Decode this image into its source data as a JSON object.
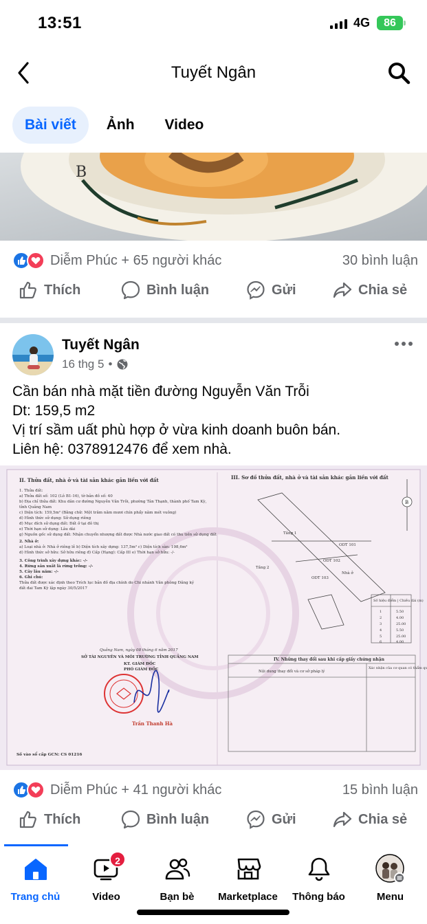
{
  "status": {
    "time": "13:51",
    "network": "4G",
    "battery": "86"
  },
  "nav": {
    "title": "Tuyết Ngân"
  },
  "tabs": [
    {
      "label": "Bài viết",
      "active": true
    },
    {
      "label": "Ảnh",
      "active": false
    },
    {
      "label": "Video",
      "active": false
    }
  ],
  "prev_post": {
    "reactions_text": "Diễm Phúc + 65 người khác",
    "comments": "30 bình luận"
  },
  "actions": {
    "like": "Thích",
    "comment": "Bình luận",
    "send": "Gửi",
    "share": "Chia sẻ"
  },
  "post": {
    "author": "Tuyết Ngân",
    "date": "16 thg 5",
    "text_lines": [
      "Cần bán nhà mặt tiền đường Nguyễn Văn Trỗi",
      "Dt: 159,5 m2",
      "Vị trí sầm uất phù hợp ở vừa kinh doanh buôn bán.",
      "Liên hệ: 0378912476 để xem nhà."
    ],
    "reactions_text": "Diễm Phúc + 41 người khác",
    "comments": "15 bình luận",
    "document": {
      "left_heading": "II. Thửa đất, nhà ở và tài sản khác gắn liền với đất",
      "right_heading": "III. Sơ đồ thửa đất, nhà ở và tài sản khác gắn liền với đất",
      "lines": [
        "1. Thửa đất:",
        "a) Thửa đất số: 102 (Lô B1-16), tờ bản đồ số: 40",
        "b) Địa chỉ thửa đất: Khu dân cư đường Nguyễn Văn Trỗi, phường Tân Thạnh, thành phố Tam Kỳ,",
        "tỉnh Quảng Nam",
        "c) Diện tích: 159,5m² (Bằng chữ: Một trăm năm mươi chín phẩy năm mét vuông)",
        "d) Hình thức sử dụng: Sử dụng riêng",
        "đ) Mục đích sử dụng đất: Đất ở tại đô thị",
        "e) Thời hạn sử dụng: Lâu dài",
        "g) Nguồn gốc sử dụng đất: Nhận chuyển nhượng đất được Nhà nước giao đất có thu tiền sử dụng đất",
        "2. Nhà ở:",
        "a) Loại nhà ở: Nhà ở riêng lẻ   b) Diện tích xây dựng: 137,5m²   c) Diện tích sàn: 198,6m²",
        "d) Hình thức sở hữu: Sở hữu riêng   đ) Cấp (Hạng): Cấp III   e) Thời hạn sở hữu: -/-",
        "3. Công trình xây dựng khác: -/-",
        "4. Rừng sản xuất là rừng trồng: -/-",
        "5. Cây lâu năm: -/-",
        "6. Ghi chú:",
        "Thửa đất được xác định theo Trích lục bản đồ địa chính do Chi nhánh Văn phòng Đăng ký",
        "đất đai Tam Kỳ lập ngày 30/5/2017"
      ],
      "date_line": "Quảng Nam, ngày 08 tháng 6 năm 2017",
      "department": "SỞ TÀI NGUYÊN VÀ MÔI TRƯỜNG TỈNH QUẢNG NAM",
      "kt": "KT. GIÁM ĐỐC",
      "deputy": "PHÓ GIÁM ĐỐC",
      "signer": "Trần Thanh Hà",
      "certificate": "Số vào sổ cấp GCN: CS 01216",
      "changes_title": "IV. Những thay đổi sau khi cấp giấy chứng nhận",
      "changes_col1": "Nội dung thay đổi và cơ sở pháp lý",
      "changes_col2": "Xác nhận của cơ quan có thẩm quyền",
      "table_header": "Số hiệu điểm | Chiều dài (m)",
      "table_rows": [
        [
          "1",
          "5.50"
        ],
        [
          "2",
          "4.00"
        ],
        [
          "3",
          "25.00"
        ],
        [
          "4",
          "5.50"
        ],
        [
          "5",
          "25.00"
        ],
        [
          "6",
          "4.00"
        ]
      ],
      "diagram_labels": [
        "ODT 101",
        "ODT 102",
        "ODT 103",
        "Tầng 1",
        "Tầng 2",
        "Nhà ở"
      ]
    }
  },
  "bottom_nav": [
    {
      "label": "Trang chủ",
      "active": true
    },
    {
      "label": "Video",
      "badge": "2"
    },
    {
      "label": "Bạn bè"
    },
    {
      "label": "Marketplace"
    },
    {
      "label": "Thông báo"
    },
    {
      "label": "Menu"
    }
  ]
}
